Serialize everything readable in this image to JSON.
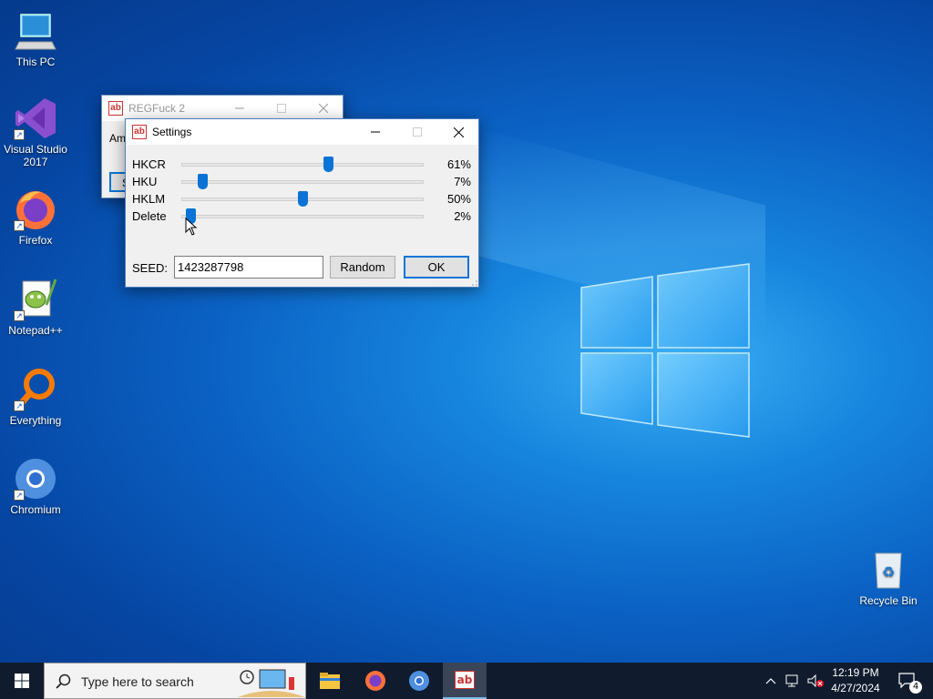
{
  "desktop": {
    "icons": [
      {
        "label": "This PC"
      },
      {
        "label": "Visual Studio 2017"
      },
      {
        "label": "Firefox"
      },
      {
        "label": "Notepad++"
      },
      {
        "label": "Everything"
      },
      {
        "label": "Chromium"
      },
      {
        "label": "Recycle Bin"
      }
    ]
  },
  "main_window": {
    "title": "REGFuck 2",
    "partial_label": "Amo",
    "partial_button": "S"
  },
  "settings": {
    "title": "Settings",
    "sliders": [
      {
        "label": "HKCR",
        "value": 61,
        "display": "61%"
      },
      {
        "label": "HKU",
        "value": 7,
        "display": "7%"
      },
      {
        "label": "HKLM",
        "value": 50,
        "display": "50%"
      },
      {
        "label": "Delete",
        "value": 2,
        "display": "2%"
      }
    ],
    "seed_label": "SEED:",
    "seed_value": "1423287798",
    "random_label": "Random",
    "ok_label": "OK"
  },
  "taskbar": {
    "search_placeholder": "Type here to search",
    "time": "12:19 PM",
    "date": "4/27/2024",
    "notification_count": "4"
  },
  "colors": {
    "accent": "#0a74d6",
    "taskbar": "#101c2e"
  }
}
